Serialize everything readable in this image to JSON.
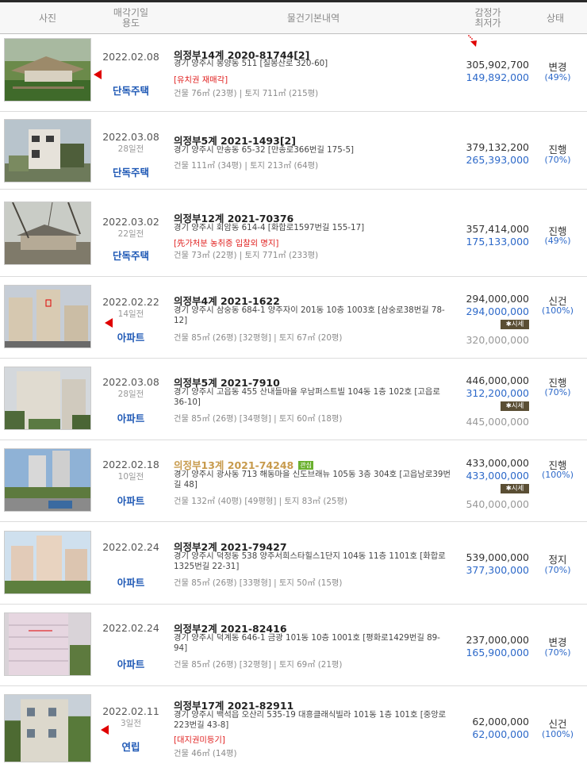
{
  "header": {
    "photo": "사진",
    "date_line1": "매각기일",
    "date_line2": "용도",
    "info": "물건기본내역",
    "price_line1": "감정가",
    "price_line2": "최저가",
    "status": "상태"
  },
  "colors": {
    "accent_blue": "#2d69c9",
    "marker_red": "#e00000",
    "special_red": "#e0201f",
    "highlight_gold": "#c79a4c"
  },
  "rows": [
    {
      "date": "2022.02.08",
      "ago": "",
      "use": "단독주택",
      "case": "의정부14계 2020-81744[2]",
      "addr": "경기 양주시 봉양동 511 [칠봉산로 320-60]",
      "special": "[유치권  재매각]",
      "area": "건물 76㎡ (23평)  |  토지 711㎡ (215평)",
      "appraisal": "305,902,700",
      "minimum": "149,892,000",
      "status": "변경",
      "percent": "(49%)"
    },
    {
      "date": "2022.03.08",
      "ago": "28일전",
      "use": "단독주택",
      "case": "의정부5계 2021-1493[2]",
      "addr": "경기 양주시 만송동 65-32 [만송로366번길 175-5]",
      "area": "건물 111㎡ (34평)  |  토지 213㎡ (64평)",
      "appraisal": "379,132,200",
      "minimum": "265,393,000",
      "status": "진행",
      "percent": "(70%)"
    },
    {
      "date": "2022.03.02",
      "ago": "22일전",
      "use": "단독주택",
      "case": "의정부12계 2021-70376",
      "addr": "경기 양주시 회암동 614-4 [화합로1597번길 155-17]",
      "special": "[先가처분  농취증  입찰외  명지]",
      "area": "건물 73㎡ (22평)  |  토지 771㎡ (233평)",
      "appraisal": "357,414,000",
      "minimum": "175,133,000",
      "status": "진행",
      "percent": "(49%)"
    },
    {
      "date": "2022.02.22",
      "ago": "14일전",
      "use": "아파트",
      "case": "의정부4계 2021-1622",
      "addr": "경기 양주시 삼숭동 684-1 양주자이 201동 10층 1003호 [삼숭로38번길 78-12]",
      "area": "건물 85㎡ (26평) [32평형]  |  토지 67㎡ (20평)",
      "appraisal": "294,000,000",
      "minimum": "294,000,000",
      "market_label": "시세",
      "market": "320,000,000",
      "status": "신건",
      "percent": "(100%)"
    },
    {
      "date": "2022.03.08",
      "ago": "28일전",
      "use": "아파트",
      "case": "의정부5계 2021-7910",
      "addr": "경기 양주시 고읍동 455 산내들마을 우남퍼스트빌 104동 1층 102호 [고읍로 36-10]",
      "area": "건물 85㎡ (26평) [34평형]  |  토지 60㎡ (18평)",
      "appraisal": "446,000,000",
      "minimum": "312,200,000",
      "market_label": "시세",
      "market": "445,000,000",
      "status": "진행",
      "percent": "(70%)"
    },
    {
      "date": "2022.02.18",
      "ago": "10일전",
      "use": "아파트",
      "case": "의정부13계 2021-74248",
      "badge": "관심",
      "addr": "경기 양주시 광사동 713 해동마을 신도브래뉴 105동 3층 304호 [고읍남로39번길 48]",
      "area": "건물 132㎡ (40평) [49평형]  |  토지 83㎡ (25평)",
      "appraisal": "433,000,000",
      "minimum": "433,000,000",
      "market_label": "시세",
      "market": "540,000,000",
      "status": "진행",
      "percent": "(100%)"
    },
    {
      "date": "2022.02.24",
      "ago": "",
      "use": "아파트",
      "case": "의정부2계 2021-79427",
      "addr": "경기 양주시 덕정동 538 양주서희스타힐스1단지 104동 11층 1101호 [화합로1325번길 22-31]",
      "area": "건물 85㎡ (26평) [33평형]  |  토지 50㎡ (15평)",
      "appraisal": "539,000,000",
      "minimum": "377,300,000",
      "status": "정지",
      "percent": "(70%)"
    },
    {
      "date": "2022.02.24",
      "ago": "",
      "use": "아파트",
      "case": "의정부2계 2021-82416",
      "addr": "경기 양주시 덕계동 646-1 금광 101동 10층 1001호 [평화로1429번길 89-94]",
      "area": "건물 85㎡ (26평) [32평형]  |  토지 69㎡ (21평)",
      "appraisal": "237,000,000",
      "minimum": "165,900,000",
      "status": "변경",
      "percent": "(70%)"
    },
    {
      "date": "2022.02.11",
      "ago": "3일전",
      "use": "연립",
      "case": "의정부17계 2021-82911",
      "addr": "경기 양주시 백석읍 오산리 535-19 대흥클래식빌라 101동 1층 101호 [중앙로223번길 43-8]",
      "special": "[대지권미등기]",
      "area": "건물 46㎡ (14평)",
      "appraisal": "62,000,000",
      "minimum": "62,000,000",
      "status": "신건",
      "percent": "(100%)"
    }
  ]
}
